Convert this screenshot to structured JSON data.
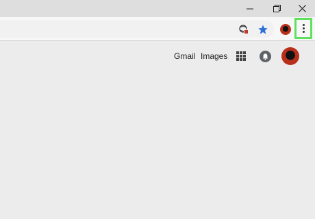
{
  "window": {
    "minimize_icon": "minimize-icon",
    "restore_icon": "restore-icon",
    "close_icon": "close-icon"
  },
  "toolbar": {
    "icons": [
      "site-settings-icon",
      "star-icon",
      "profile-avatar-icon",
      "menu-kebab-icon"
    ],
    "star_color": "#2f6fd6",
    "highlight_color": "#5fe15f"
  },
  "google_bar": {
    "gmail": "Gmail",
    "images": "Images",
    "apps_icon": "apps-grid-icon",
    "notifications_icon": "notifications-icon",
    "account_avatar": "account-avatar"
  }
}
